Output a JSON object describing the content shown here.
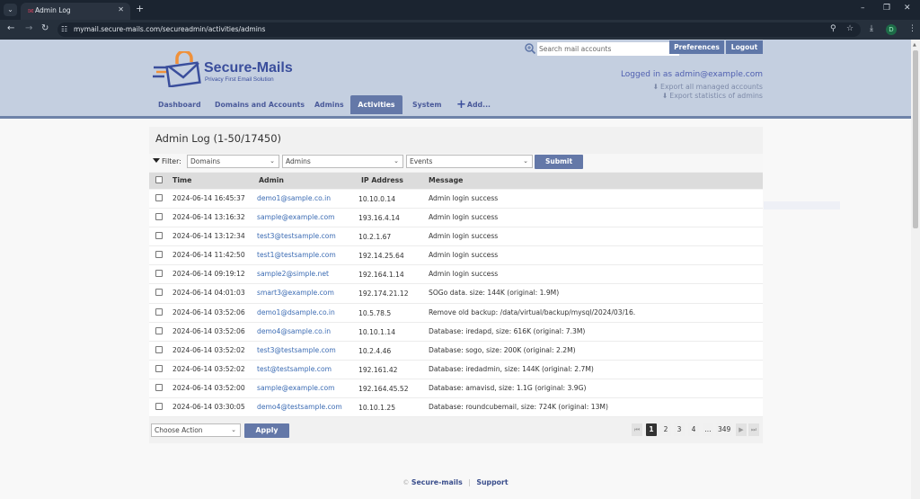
{
  "browser": {
    "tab_title": "Admin Log",
    "url": "mymail.secure-mails.com/secureadmin/activities/admins",
    "profile_initial": "D"
  },
  "header": {
    "brand_name": "Secure-Mails",
    "brand_tagline": "Privacy First Email Solution",
    "search_placeholder": "Search mail accounts",
    "preferences_label": "Preferences",
    "logout_label": "Logout",
    "logged_in_text": "Logged in as admin@example.com",
    "export_accounts_label": "Export all managed accounts",
    "export_stats_label": "Export statistics of admins",
    "colors": {
      "accent": "#6478a8",
      "header_bg": "#c4cfe0",
      "brand_blue": "#3a4e9c",
      "brand_orange": "#f0913a"
    }
  },
  "nav": {
    "items": [
      {
        "label": "Dashboard",
        "active": false
      },
      {
        "label": "Domains and Accounts",
        "active": false
      },
      {
        "label": "Admins",
        "active": false
      },
      {
        "label": "Activities",
        "active": true
      },
      {
        "label": "System",
        "active": false
      },
      {
        "label": "Add...",
        "active": false
      }
    ]
  },
  "log": {
    "title": "Admin Log (1-50/17450)",
    "filter_label": "Filter:",
    "filters": {
      "domains": "Domains",
      "admins": "Admins",
      "events": "Events"
    },
    "submit_label": "Submit",
    "columns": [
      "Time",
      "Admin",
      "IP Address",
      "Message"
    ],
    "rows": [
      {
        "time": "2024-06-14 16:45:37",
        "admin": "demo1@sample.co.in",
        "ip": "10.10.0.14",
        "message": "Admin login success"
      },
      {
        "time": "2024-06-14 13:16:32",
        "admin": "sample@example.com",
        "ip": "193.16.4.14",
        "message": "Admin login success"
      },
      {
        "time": "2024-06-14 13:12:34",
        "admin": "test3@testsample.com",
        "ip": "10.2.1.67",
        "message": "Admin login success"
      },
      {
        "time": "2024-06-14 11:42:50",
        "admin": "test1@testsample.com",
        "ip": "192.14.25.64",
        "message": "Admin login success"
      },
      {
        "time": "2024-06-14 09:19:12",
        "admin": "sample2@simple.net",
        "ip": "192.164.1.14",
        "message": "Admin login success"
      },
      {
        "time": "2024-06-14 04:01:03",
        "admin": "smart3@example.com",
        "ip": "192.174.21.12",
        "message": "SOGo data. size: 144K (original: 1.9M)"
      },
      {
        "time": "2024-06-14 03:52:06",
        "admin": "demo1@dsample.co.in",
        "ip": "10.5.78.5",
        "message": "Remove old backup: /data/virtual/backup/mysql/2024/03/16."
      },
      {
        "time": "2024-06-14 03:52:06",
        "admin": "demo4@sample.co.in",
        "ip": "10.10.1.14",
        "message": "Database: iredapd, size: 616K (original: 7.3M)"
      },
      {
        "time": "2024-06-14 03:52:02",
        "admin": "test3@testsample.com",
        "ip": "10.2.4.46",
        "message": "Database: sogo, size: 200K (original: 2.2M)"
      },
      {
        "time": "2024-06-14 03:52:02",
        "admin": "test@testsample.com",
        "ip": "192.161.42",
        "message": "Database: iredadmin, size: 144K (original: 2.7M)"
      },
      {
        "time": "2024-06-14 03:52:00",
        "admin": "sample@example.com",
        "ip": "192.164.45.52",
        "message": "Database: amavisd, size: 1.1G (original: 3.9G)"
      },
      {
        "time": "2024-06-14 03:30:05",
        "admin": "demo4@testsample.com",
        "ip": "10.10.1.25",
        "message": "Database: roundcubemail, size: 724K (original: 13M)"
      }
    ],
    "action_select": "Choose Action",
    "apply_label": "Apply",
    "pagination": {
      "pages": [
        "1",
        "2",
        "3",
        "4"
      ],
      "ellipsis": "...",
      "last_page": "349",
      "current": "1"
    }
  },
  "footer": {
    "copyright": "©",
    "brand_link": "Secure-mails",
    "support_link": "Support"
  }
}
